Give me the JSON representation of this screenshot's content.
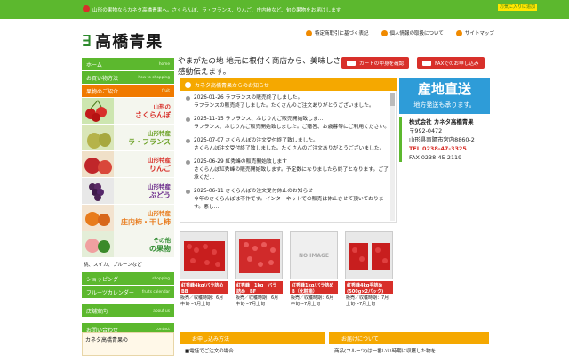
{
  "top": {
    "text": "山形の果物ならカネタ高橋青果へ。さくらんぼ、ラ・フランス、りんご、庄内柿など、旬の果物をお届けします",
    "favorite": "お気に入りに追加"
  },
  "logo": {
    "mark": "∃",
    "name": "高橋青果"
  },
  "toplinks": [
    {
      "label": "特定商取引に基づく表記"
    },
    {
      "label": "個人情報の取扱について"
    },
    {
      "label": "サイトマップ"
    }
  ],
  "tagline": "やまがたの地 地元に根付く商店から、美味しさと感動伝えます。",
  "cart_label": "カートの中身を確認",
  "fax_label": "FAXでのお申し込み",
  "nav": [
    {
      "label": "ホーム",
      "sub": "home"
    },
    {
      "label": "お買い物方法",
      "sub": "how to shopping"
    },
    {
      "label": "果物のご紹介",
      "sub": "fruit"
    }
  ],
  "fruits": [
    {
      "a": "山形の",
      "b": "さくらんぼ"
    },
    {
      "a": "山形特産",
      "b": "ラ・フランス"
    },
    {
      "a": "山形特産",
      "b": "りんご"
    },
    {
      "a": "山形特産",
      "b": "ぶどう"
    },
    {
      "a": "山形特産",
      "b": "庄内柿・干し柿"
    },
    {
      "a": "その他",
      "b": "の果物"
    }
  ],
  "fruit_extra": "桃、スイカ、プルーンなど",
  "nav2": [
    {
      "label": "ショッピング",
      "sub": "shopping"
    },
    {
      "label": "フルーツカレンダー",
      "sub": "fruits calendar"
    },
    {
      "label": "店舗案内",
      "sub": "about us"
    },
    {
      "label": "お問い合わせ",
      "sub": "contact"
    }
  ],
  "banner": "カネタ高橋青果の",
  "news": {
    "title": "カネタ高橋青果からのお知らせ",
    "items": [
      {
        "date": "2026-01-26 ラフランスの販売終了しました。",
        "body": "ラフランスの販売終了しました。たくさんのご注文ありがとうございました。"
      },
      {
        "date": "2025-11-15 ラフランス、ふじりんご販売開始致しま…",
        "body": "ラフランス、ふじりんご販売開始致しました。ご贈答、お歳暮等にご利用ください。"
      },
      {
        "date": "2025-07-07 さくらんぼの注文受付終了致しました。",
        "body": "さくらんぼ注文受付終了致しました。たくさんのご注文ありがとうございました。"
      },
      {
        "date": "2025-06-29 紅秀峰の販売開始致します",
        "body": "さくらんぼ紅秀峰の販売開始致します。予定数になりましたら終了となります。ご了承くだ…"
      },
      {
        "date": "2025-06-11 さくらんぼの注文受付休止のお知らせ",
        "body": "今年のさくらんぼは不作です。インターネットでの販売は休止させて頂いております。悪し…"
      }
    ]
  },
  "area": {
    "title": "産地直送",
    "sub": "地方発送も承ります。"
  },
  "company": {
    "name": "株式会社 カネタ高橋青果",
    "zip": "〒992-0472",
    "addr": "山形県南陽市宮内8860-2",
    "tel": "TEL 0238-47-3325",
    "fax": "FAX 0238-45-2119"
  },
  "products": [
    {
      "name": "紅秀峰4kg/バラ詰め　BB",
      "info": "販売／収穫時期：6月中旬〜7月上旬",
      "img": "cherries"
    },
    {
      "name": "紅秀峰　1kg　バラ詰め　BF",
      "info": "販売／収穫時期：6月中旬〜7月上旬",
      "img": "cherries"
    },
    {
      "name": "紅秀峰1kg/バラ詰め　B（化粧箱）",
      "info": "販売／収穫時期：6月中旬〜7月上旬",
      "img": "noimage",
      "noimage_text": "NO IMAGE"
    },
    {
      "name": "紅秀峰4kg手詰め(500g×2パック) BC",
      "info": "販売／収穫時期：7月上旬〜7月上旬",
      "img": "cherries"
    }
  ],
  "order_title": "お申し込み方法",
  "order_text": "■電話でご注文の場合",
  "deliver_title": "お届けについて",
  "deliver_text": "商品(フルーツ)は一番いい時期に収穫した物を"
}
